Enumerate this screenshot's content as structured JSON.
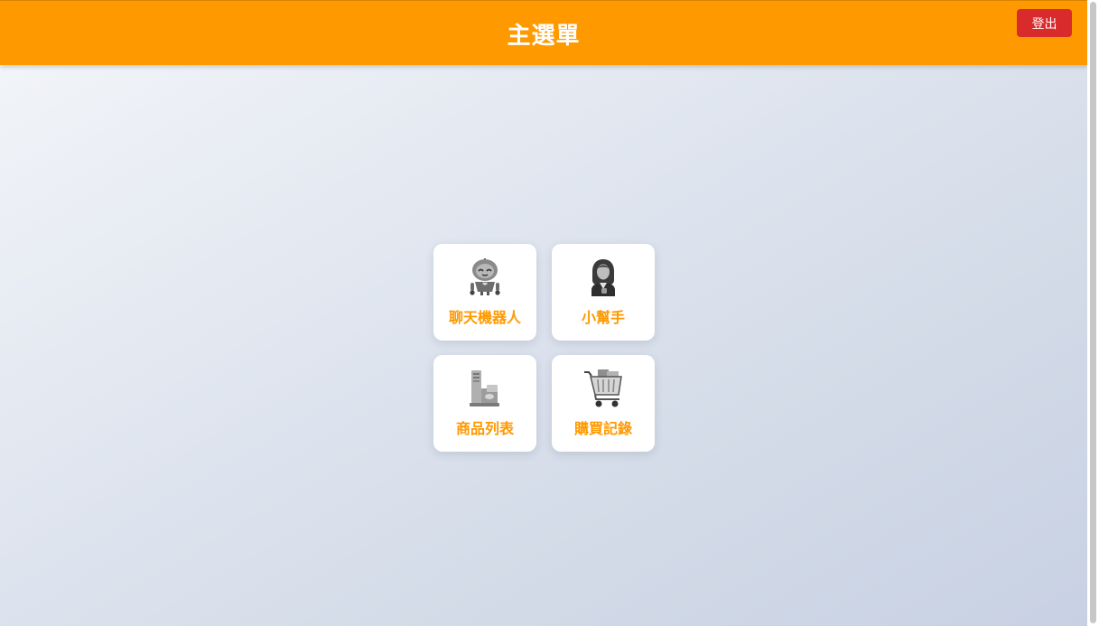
{
  "header": {
    "title": "主選單",
    "logout_label": "登出"
  },
  "menu": {
    "items": [
      {
        "label": "聊天機器人",
        "icon": "robot-icon"
      },
      {
        "label": "小幫手",
        "icon": "assistant-woman-icon"
      },
      {
        "label": "商品列表",
        "icon": "product-list-icon"
      },
      {
        "label": "購買記錄",
        "icon": "shopping-cart-icon"
      }
    ]
  },
  "colors": {
    "header_bg": "#ff9900",
    "logout_bg": "#d92b2b",
    "label_color": "#ff9900",
    "card_bg": "#ffffff"
  }
}
